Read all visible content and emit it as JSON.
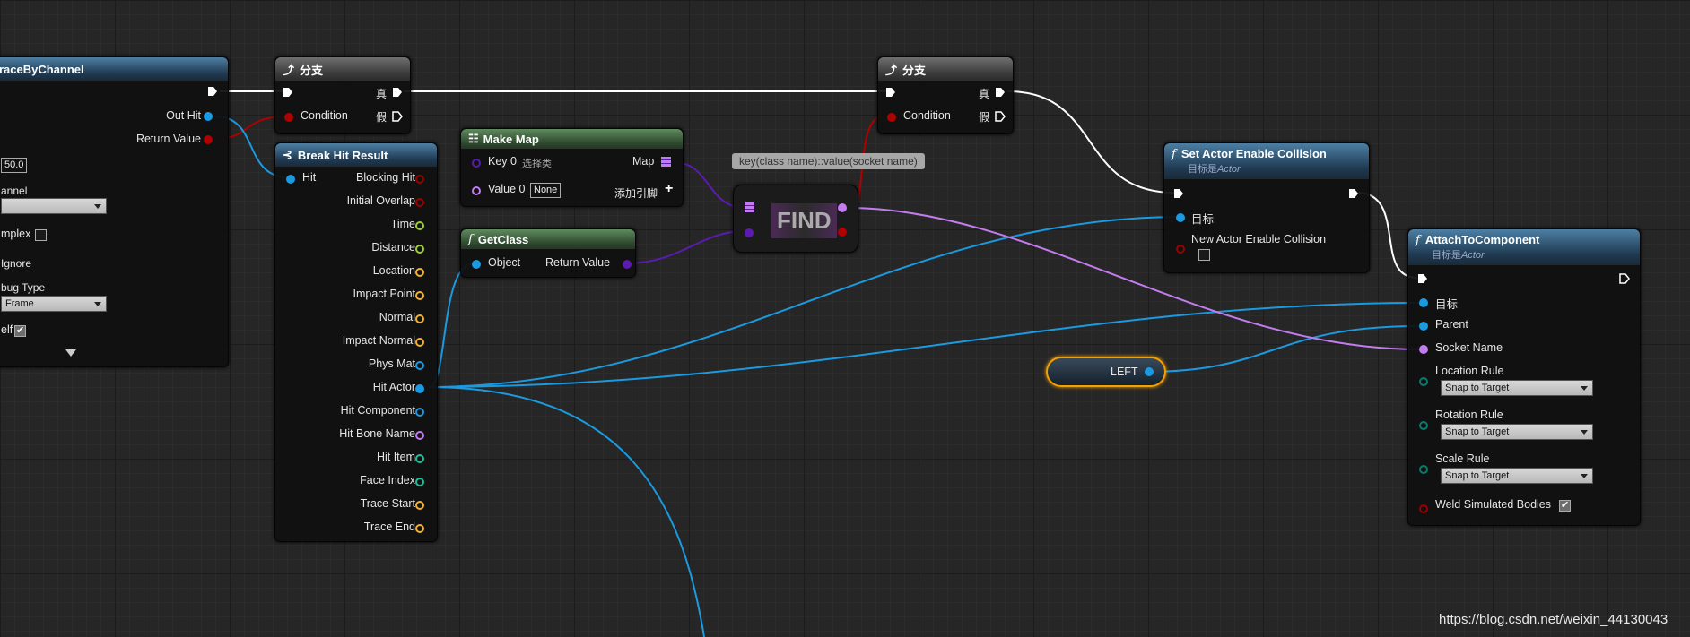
{
  "trace_node": {
    "title": "raceByChannel",
    "out_hit": "Out Hit",
    "return_value": "Return Value",
    "draw_time": "50.0",
    "channel_label": "annel",
    "complex_label": "mplex",
    "ignore_label": "Ignore",
    "debug_type_label": "bug Type",
    "debug_type_value": "Frame",
    "self_label": "elf",
    "self_checked": true
  },
  "branch1": {
    "title": "分支",
    "condition": "Condition",
    "true_label": "真",
    "false_label": "假"
  },
  "branch2": {
    "title": "分支",
    "condition": "Condition",
    "true_label": "真",
    "false_label": "假"
  },
  "break_hit": {
    "title": "Break Hit Result",
    "input": "Hit",
    "outputs": [
      {
        "label": "Blocking Hit",
        "color": "#9b0000"
      },
      {
        "label": "Initial Overlap",
        "color": "#9b0000"
      },
      {
        "label": "Time",
        "color": "#9ecf32"
      },
      {
        "label": "Distance",
        "color": "#9ecf32"
      },
      {
        "label": "Location",
        "color": "#f3b22c"
      },
      {
        "label": "Impact Point",
        "color": "#f3b22c"
      },
      {
        "label": "Normal",
        "color": "#f3b22c"
      },
      {
        "label": "Impact Normal",
        "color": "#f3b22c"
      },
      {
        "label": "Phys Mat",
        "color": "#1a9ae0"
      },
      {
        "label": "Hit Actor",
        "color": "#1a9ae0"
      },
      {
        "label": "Hit Component",
        "color": "#1a9ae0"
      },
      {
        "label": "Hit Bone Name",
        "color": "#c27cf0"
      },
      {
        "label": "Hit Item",
        "color": "#1fbf9c"
      },
      {
        "label": "Face Index",
        "color": "#1fbf9c"
      },
      {
        "label": "Trace Start",
        "color": "#f3b22c"
      },
      {
        "label": "Trace End",
        "color": "#f3b22c"
      }
    ]
  },
  "make_map": {
    "title": "Make Map",
    "key0": "Key 0",
    "key0_select": "选择类",
    "value0": "Value 0",
    "value0_value": "None",
    "map": "Map",
    "add_pin": "添加引脚"
  },
  "get_class": {
    "title": "GetClass",
    "object": "Object",
    "return_value": "Return Value"
  },
  "find": {
    "label": "FIND",
    "tooltip": "key(class name)::value(socket name)"
  },
  "set_collision": {
    "title": "Set Actor Enable Collision",
    "subtitle_prefix": "目标是",
    "subtitle_target": "Actor",
    "target": "目标",
    "new_enable": "New Actor Enable Collision",
    "checked": false
  },
  "attach": {
    "title": "AttachToComponent",
    "subtitle_prefix": "目标是",
    "subtitle_target": "Actor",
    "target": "目标",
    "parent": "Parent",
    "socket": "Socket Name",
    "location_rule": "Location Rule",
    "location_value": "Snap to Target",
    "rotation_rule": "Rotation Rule",
    "rotation_value": "Snap to Target",
    "scale_rule": "Scale Rule",
    "scale_value": "Snap to Target",
    "weld": "Weld Simulated Bodies",
    "weld_checked": true
  },
  "left_var": {
    "label": "LEFT"
  },
  "watermark": "https://blog.csdn.net/weixin_44130043",
  "colors": {
    "object_pin": "#1a9ae0",
    "bool_pin": "#9b0000",
    "name_pin": "#c27cf0",
    "class_pin": "#5b1bb0",
    "exec_wire": "#ffffff"
  }
}
